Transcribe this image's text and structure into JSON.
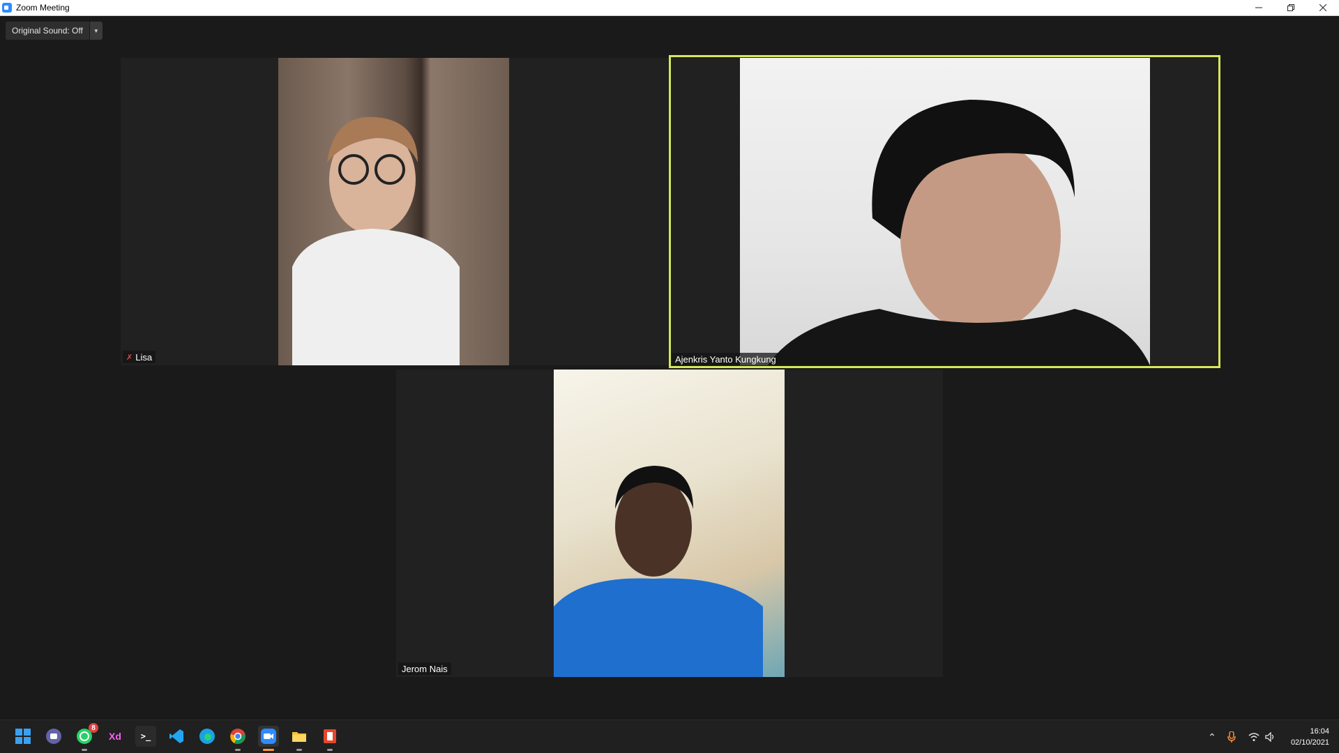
{
  "window": {
    "title": "Zoom Meeting",
    "controls": [
      "minimize-icon",
      "restore-icon",
      "close-icon"
    ]
  },
  "toolbar": {
    "original_sound_label": "Original Sound: Off"
  },
  "participants": [
    {
      "name": "Lisa",
      "muted": true,
      "active_speaker": false
    },
    {
      "name": "Ajenkris Yanto Kungkung",
      "muted": false,
      "active_speaker": true
    },
    {
      "name": "Jerom Nais",
      "muted": false,
      "active_speaker": false
    }
  ],
  "colors": {
    "active_speaker_border": "#d6e85a",
    "zoom_blue": "#2d8cff",
    "muted_red": "#e34b4b"
  },
  "taskbar": {
    "apps": [
      {
        "icon": "windows-start-icon"
      },
      {
        "icon": "teams-chat-icon"
      },
      {
        "icon": "whatsapp-icon",
        "badge": "8"
      },
      {
        "icon": "adobe-xd-icon",
        "label": "Xd"
      },
      {
        "icon": "terminal-icon",
        "label": ">_"
      },
      {
        "icon": "vscode-icon"
      },
      {
        "icon": "edge-icon"
      },
      {
        "icon": "chrome-icon"
      },
      {
        "icon": "zoom-icon"
      },
      {
        "icon": "file-explorer-icon"
      },
      {
        "icon": "office-icon"
      }
    ],
    "tray": [
      "chevron-up-icon",
      "microphone-icon",
      "wifi-icon",
      "volume-icon"
    ],
    "time": "16:04",
    "date": "02/10/2021"
  }
}
